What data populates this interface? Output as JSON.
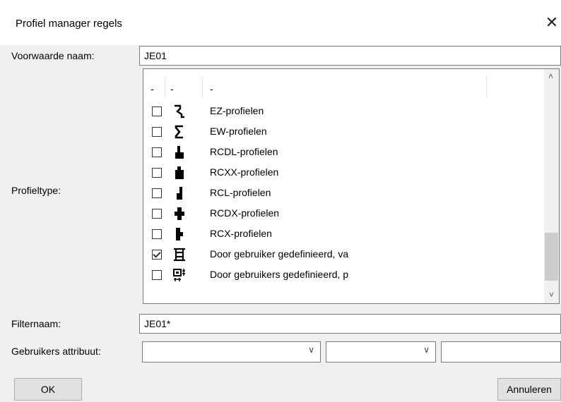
{
  "dialog": {
    "title": "Profiel manager regels",
    "close_glyph": "✕"
  },
  "form": {
    "voorwaarde_label": "Voorwaarde naam:",
    "voorwaarde_value": "JE01",
    "profieltype_label": "Profieltype:",
    "filternaam_label": "Filternaam:",
    "filternaam_value": "JE01*",
    "gebruikers_label": "Gebruikers attribuut:"
  },
  "list": {
    "headers": [
      "-",
      "-",
      "-"
    ],
    "rows": [
      {
        "label": "EZ-profielen",
        "checked": false,
        "icon": "ez-profile-icon"
      },
      {
        "label": "EW-profielen",
        "checked": false,
        "icon": "ew-profile-icon"
      },
      {
        "label": "RCDL-profielen",
        "checked": false,
        "icon": "rcdl-profile-icon"
      },
      {
        "label": "RCXX-profielen",
        "checked": false,
        "icon": "rcxx-profile-icon"
      },
      {
        "label": "RCL-profielen",
        "checked": false,
        "icon": "rcl-profile-icon"
      },
      {
        "label": "RCDX-profielen",
        "checked": false,
        "icon": "rcdx-profile-icon"
      },
      {
        "label": "RCX-profielen",
        "checked": false,
        "icon": "rcx-profile-icon"
      },
      {
        "label": "Door gebruiker gedefinieerd, va",
        "checked": true,
        "icon": "user-defined-profile-icon"
      },
      {
        "label": "Door gebruikers gedefinieerd, p",
        "checked": false,
        "icon": "user-defined-parametric-icon"
      }
    ]
  },
  "buttons": {
    "ok": "OK",
    "cancel": "Annuleren"
  },
  "colors": {
    "background": "#f0f0f0",
    "field": "#ffffff",
    "border": "#7a7a7a"
  }
}
